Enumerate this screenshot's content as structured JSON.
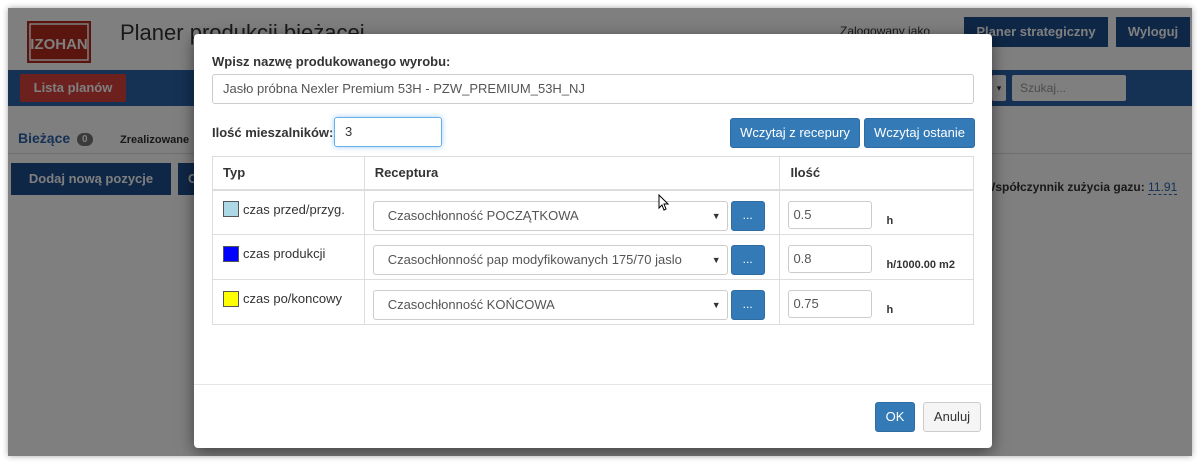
{
  "app": {
    "logo_text": "IZOHAN",
    "title": "Planer produkcji bieżącej",
    "logged_as": "Zalogowany jako",
    "btn_strategic": "Planer strategiczny",
    "btn_logout": "Wyloguj"
  },
  "navbar": {
    "btn_lista": "Lista planów",
    "select_arrow": "▾",
    "search_placeholder": "Szukaj..."
  },
  "tabs": {
    "current": "Bieżące",
    "current_count": "0",
    "realized": "Zrealizowane"
  },
  "toolbar": {
    "btn_add": "Dodaj nową pozycje",
    "btn_c": "C"
  },
  "gas": {
    "label": "Współczynnik zużycia gazu:",
    "value": "11.91"
  },
  "modal": {
    "name_label": "Wpisz nazwę produkowanego wyrobu:",
    "name_value": "Jasło próbna  Nexler Premium 53H - PZW_PREMIUM_53H_NJ",
    "mixers_label": "Ilość mieszalników:",
    "mixers_value": "3",
    "btn_recipe": "Wczytaj z recepury",
    "btn_last": "Wczytaj ostanie",
    "table": {
      "headers": [
        "Typ",
        "Receptura",
        "Ilość"
      ],
      "rows": [
        {
          "color": "#add8e6",
          "type": "czas przed/przyg.",
          "recipe": "Czasochłonność POCZĄTKOWA",
          "btn": "...",
          "value": "0.5",
          "unit": "h"
        },
        {
          "color": "#0000ff",
          "type": "czas produkcji",
          "recipe": "Czasochłonność pap modyfikowanych 175/70 jaslo",
          "btn": "...",
          "value": "0.8",
          "unit": "h/1000.00 m2"
        },
        {
          "color": "#ffff00",
          "type": "czas po/koncowy",
          "recipe": "Czasochłonność KOŃCOWA",
          "btn": "...",
          "value": "0.75",
          "unit": "h"
        }
      ]
    },
    "btn_ok": "OK",
    "btn_cancel": "Anuluj"
  }
}
